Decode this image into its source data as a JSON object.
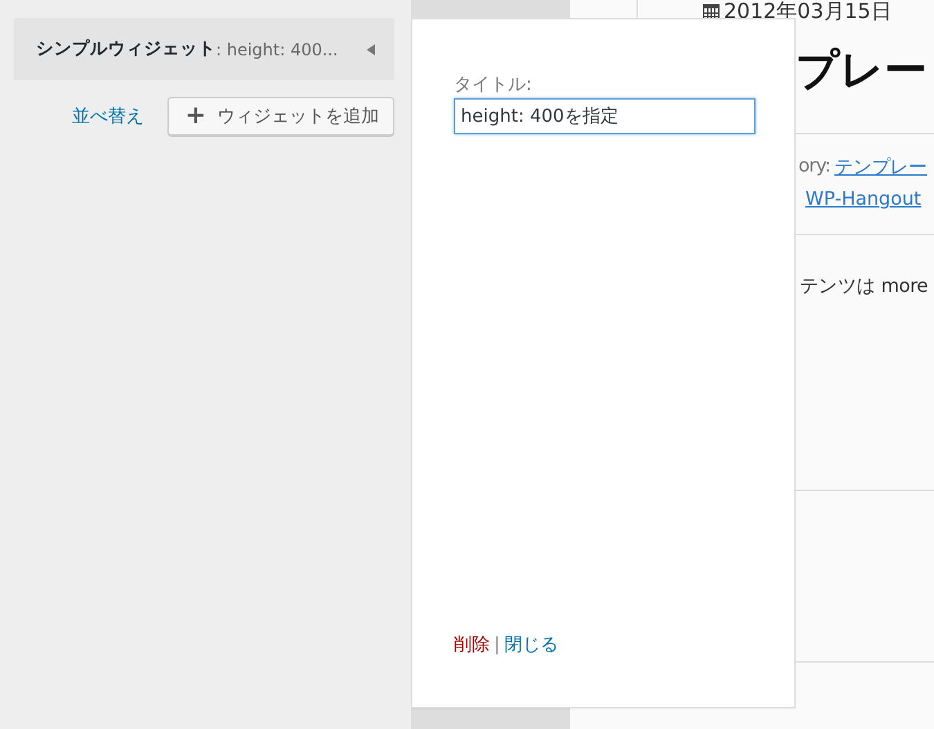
{
  "sidebar": {
    "widget": {
      "name": "シンプルウィジェット",
      "title": ": height: 400..."
    },
    "reorder_link": "並べ替え",
    "add_button": {
      "icon": "+",
      "label": "ウィジェットを追加"
    }
  },
  "widget_panel": {
    "field": {
      "label": "タイトル:",
      "value": "height: 400を指定"
    },
    "delete_link": "削除",
    "separator": "|",
    "close_link": "閉じる"
  },
  "preview": {
    "date": "2012年03月15日",
    "heading": "プレー",
    "category_label": "ory:",
    "category_link": "テンプレー",
    "tag_link": "WP-Hangout",
    "content": "テンツは more"
  }
}
